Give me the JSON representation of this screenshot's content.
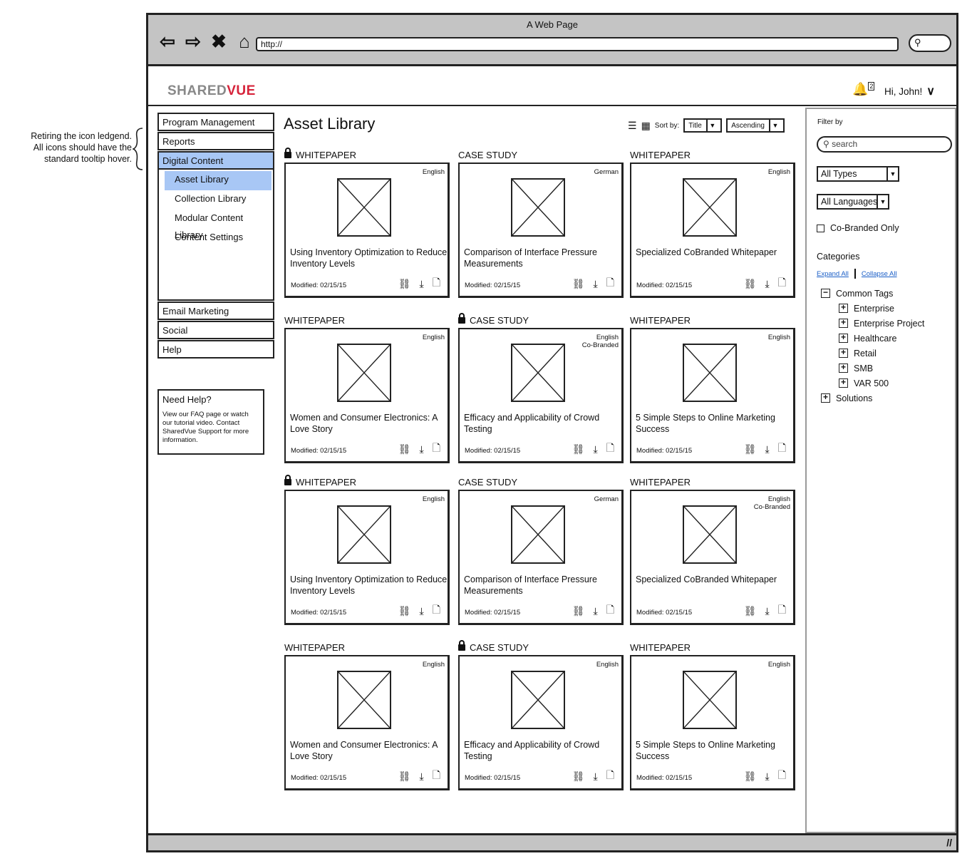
{
  "annotation": {
    "lines": [
      "Retiring the icon ledgend.",
      "All icons should have the",
      "standard tooltip hover."
    ]
  },
  "browser": {
    "window_title": "A Web Page",
    "url": "http://"
  },
  "header": {
    "logo_a": "SHARED",
    "logo_b": "VUE",
    "notification_count": "2",
    "greeting": "Hi, John!"
  },
  "nav": {
    "top_items": [
      "Program Management",
      "Reports",
      "Digital Content"
    ],
    "sub_items": [
      "Asset Library",
      "Collection Library",
      "Modular Content Library",
      "Content Settings"
    ],
    "bottom_items": [
      "Email Marketing",
      "Social",
      "Help"
    ]
  },
  "help": {
    "heading": "Need Help?",
    "text": "View our FAQ page or watch our tutorial video. Contact SharedVue Support for more information."
  },
  "main": {
    "title": "Asset Library",
    "sort_label": "Sort by:",
    "sort_field": "Title",
    "sort_order": "Ascending"
  },
  "cards": [
    {
      "type": "WHITEPAPER",
      "locked": true,
      "lang": "English",
      "lang2": "",
      "desc": "Using Inventory Optimization to Reduce Inventory Levels",
      "modified": "Modified: 02/15/15"
    },
    {
      "type": "CASE STUDY",
      "locked": false,
      "lang": "German",
      "lang2": "",
      "desc": "Comparison of Interface Pressure Measurements",
      "modified": "Modified: 02/15/15"
    },
    {
      "type": "WHITEPAPER",
      "locked": false,
      "lang": "English",
      "lang2": "",
      "desc": "Specialized CoBranded Whitepaper",
      "modified": "Modified: 02/15/15"
    },
    {
      "type": "WHITEPAPER",
      "locked": false,
      "lang": "English",
      "lang2": "",
      "desc": "Women and Consumer Electronics: A Love Story",
      "modified": "Modified: 02/15/15"
    },
    {
      "type": "CASE STUDY",
      "locked": true,
      "lang": "English",
      "lang2": "Co-Branded",
      "desc": "Efficacy and Applicability of Crowd Testing",
      "modified": "Modified: 02/15/15"
    },
    {
      "type": "WHITEPAPER",
      "locked": false,
      "lang": "English",
      "lang2": "",
      "desc": "5 Simple Steps to Online Marketing Success",
      "modified": "Modified: 02/15/15"
    },
    {
      "type": "WHITEPAPER",
      "locked": true,
      "lang": "English",
      "lang2": "",
      "desc": "Using Inventory Optimization to Reduce Inventory Levels",
      "modified": "Modified: 02/15/15"
    },
    {
      "type": "CASE STUDY",
      "locked": false,
      "lang": "German",
      "lang2": "",
      "desc": "Comparison of Interface Pressure Measurements",
      "modified": "Modified: 02/15/15"
    },
    {
      "type": "WHITEPAPER",
      "locked": false,
      "lang": "English",
      "lang2": "Co-Branded",
      "desc": "Specialized CoBranded Whitepaper",
      "modified": "Modified: 02/15/15"
    },
    {
      "type": "WHITEPAPER",
      "locked": false,
      "lang": "English",
      "lang2": "",
      "desc": "Women and Consumer Electronics: A Love Story",
      "modified": "Modified: 02/15/15"
    },
    {
      "type": "CASE STUDY",
      "locked": true,
      "lang": "English",
      "lang2": "",
      "desc": "Efficacy and Applicability of Crowd Testing",
      "modified": "Modified: 02/15/15"
    },
    {
      "type": "WHITEPAPER",
      "locked": false,
      "lang": "English",
      "lang2": "",
      "desc": "5 Simple Steps to Online Marketing Success",
      "modified": "Modified: 02/15/15"
    }
  ],
  "filter": {
    "label": "Filter by",
    "search_placeholder": "search",
    "types": "All Types",
    "languages": "All Languages",
    "cobranded": "Co-Branded Only",
    "categories_label": "Categories",
    "expand_all": "Expand All",
    "collapse_all": "Collapse All",
    "tree_root": "Common Tags",
    "tree_children": [
      "Enterprise",
      "Enterprise Project",
      "Healthcare",
      "Retail",
      "SMB",
      "VAR 500"
    ],
    "tree_last": "Solutions"
  },
  "icons": {
    "back": "arrow-left-icon",
    "forward": "arrow-right-icon",
    "stop": "close-icon",
    "home": "home-icon",
    "bell": "notification-icon",
    "link": "link-icon",
    "download": "download-icon",
    "doc": "document-icon",
    "list": "list-view-icon",
    "grid": "grid-view-icon"
  },
  "colors": {
    "selected": "#a8c7f5",
    "brand_red": "#d6233a",
    "brand_gray": "#888888",
    "chrome": "#c4c4c4",
    "link": "#1b5fc7"
  }
}
